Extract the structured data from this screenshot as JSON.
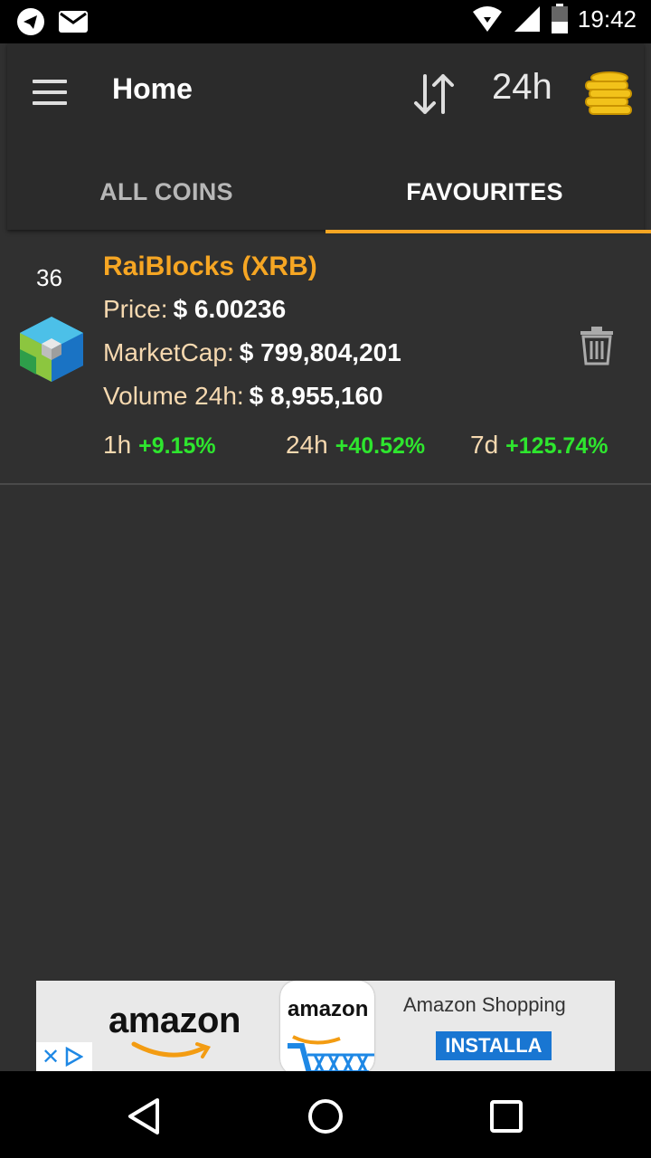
{
  "status_bar": {
    "time": "19:42",
    "icons": [
      "telegram-icon",
      "mail-icon",
      "wifi-icon",
      "signal-icon",
      "battery-icon"
    ]
  },
  "app_bar": {
    "title": "Home",
    "period": "24h",
    "icons": [
      "menu-icon",
      "sort-icon",
      "coins-icon"
    ]
  },
  "tabs": [
    {
      "label": "ALL COINS",
      "selected": false
    },
    {
      "label": "FAVOURITES",
      "selected": true
    }
  ],
  "colors": {
    "accent": "#f6a623",
    "positive": "#2ee62e",
    "background": "#303030"
  },
  "coin": {
    "rank": "36",
    "name": "RaiBlocks (XRB)",
    "price_label": "Price:",
    "price": "$ 6.00236",
    "market_cap_label": "MarketCap:",
    "market_cap": "$ 799,804,201",
    "volume_label": "Volume 24h:",
    "volume": "$ 8,955,160",
    "change_1h_label": "1h",
    "change_1h": "+9.15%",
    "change_24h_label": "24h",
    "change_24h": "+40.52%",
    "change_7d_label": "7d",
    "change_7d": "+125.74%"
  },
  "ad": {
    "brand": "amazon",
    "app_name": "amazon",
    "title": "Amazon Shopping",
    "button": "INSTALLA"
  },
  "nav_bar": {
    "icons": [
      "back-icon",
      "home-icon",
      "recent-apps-icon"
    ]
  }
}
